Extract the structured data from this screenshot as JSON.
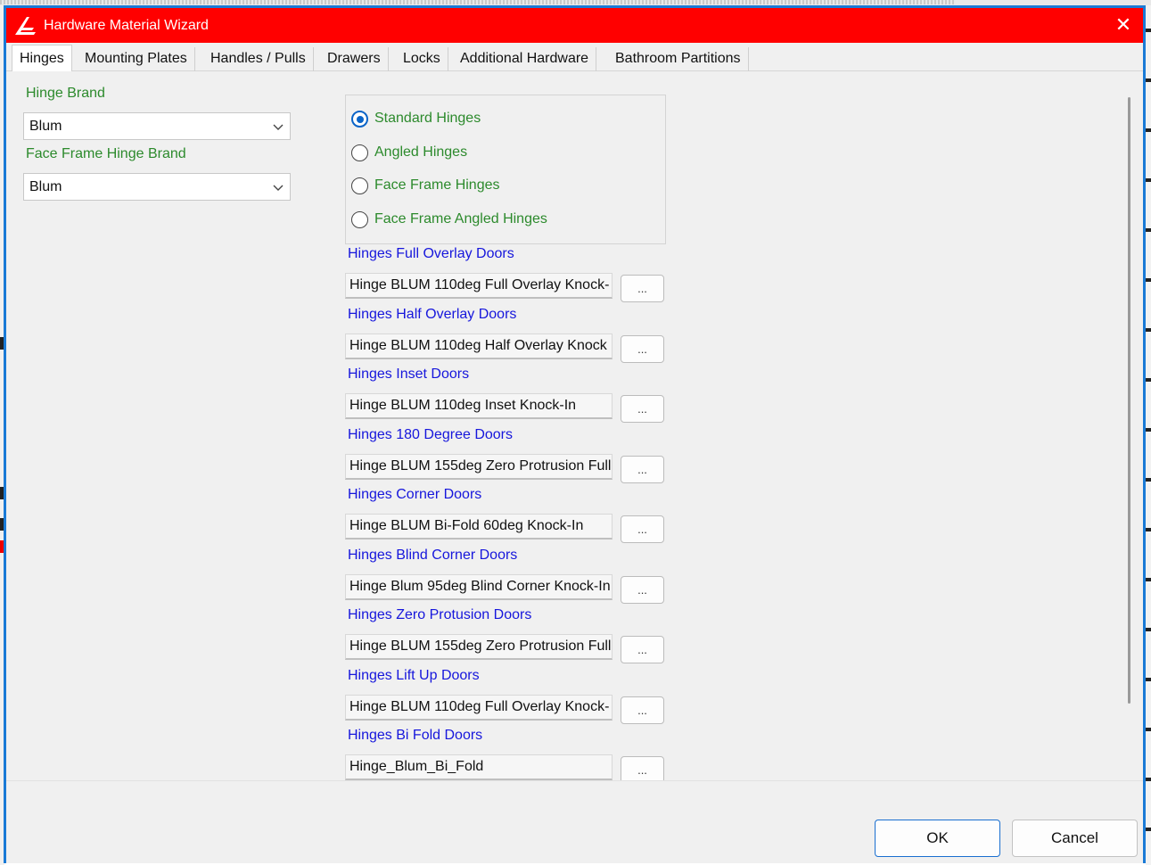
{
  "window": {
    "title": "Hardware Material Wizard",
    "close_symbol": "✕",
    "accent_color": "#ff0000",
    "border_color": "#1a7ad6"
  },
  "tabs": [
    {
      "label": "Hinges",
      "active": true
    },
    {
      "label": "Mounting Plates"
    },
    {
      "label": "Handles / Pulls"
    },
    {
      "label": "Drawers"
    },
    {
      "label": "Locks"
    },
    {
      "label": "Additional Hardware"
    },
    {
      "label": "Bathroom Partitions"
    }
  ],
  "left": {
    "hinge_brand_label": "Hinge Brand",
    "hinge_brand_value": "Blum",
    "face_frame_brand_label": "Face Frame Hinge Brand",
    "face_frame_brand_value": "Blum"
  },
  "hinge_type": {
    "selected": "Standard Hinges",
    "options": [
      "Standard Hinges",
      "Angled Hinges",
      "Face Frame Hinges",
      "Face Frame Angled Hinges"
    ]
  },
  "hinge_fields": [
    {
      "label": "Hinges Full Overlay Doors",
      "value": "Hinge BLUM 110deg Full Overlay Knock-"
    },
    {
      "label": "Hinges Half Overlay Doors",
      "value": "Hinge BLUM 110deg Half Overlay Knock"
    },
    {
      "label": "Hinges Inset Doors",
      "value": "Hinge BLUM 110deg Inset Knock-In"
    },
    {
      "label": "Hinges 180 Degree Doors",
      "value": "Hinge BLUM 155deg Zero Protrusion Full"
    },
    {
      "label": "Hinges Corner Doors",
      "value": "Hinge BLUM Bi-Fold 60deg Knock-In"
    },
    {
      "label": "Hinges Blind Corner Doors",
      "value": "Hinge Blum 95deg Blind Corner Knock-In"
    },
    {
      "label": "Hinges Zero Protusion Doors",
      "value": "Hinge BLUM 155deg Zero Protrusion Full"
    },
    {
      "label": "Hinges Lift Up Doors",
      "value": "Hinge BLUM 110deg Full Overlay Knock-"
    },
    {
      "label": "Hinges Bi Fold Doors",
      "value": "Hinge_Blum_Bi_Fold"
    }
  ],
  "browse_label": "...",
  "footer": {
    "ok_label": "OK",
    "cancel_label": "Cancel"
  }
}
